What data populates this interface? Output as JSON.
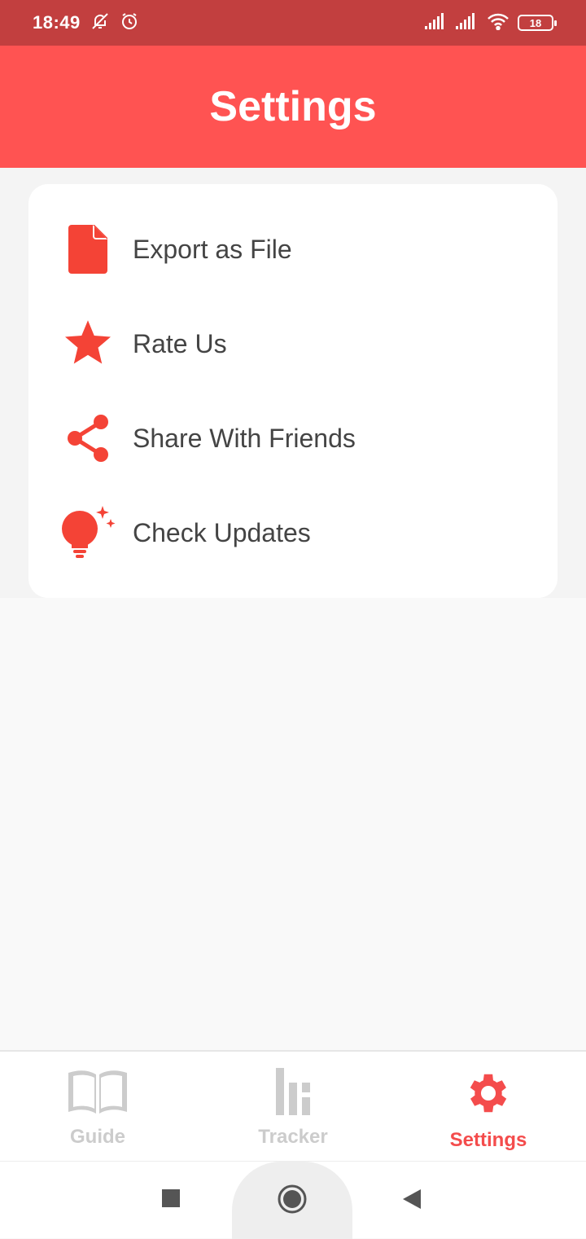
{
  "status_bar": {
    "time": "18:49",
    "battery": "18",
    "icons": [
      "bell-off-icon",
      "alarm-icon",
      "signal-icon",
      "signal-icon",
      "wifi-icon",
      "battery-icon"
    ]
  },
  "header": {
    "title": "Settings"
  },
  "menu": {
    "items": [
      {
        "label": "Export as File",
        "icon": "file-icon"
      },
      {
        "label": "Rate Us",
        "icon": "star-icon"
      },
      {
        "label": "Share With Friends",
        "icon": "share-icon"
      },
      {
        "label": "Check Updates",
        "icon": "lightbulb-icon"
      }
    ]
  },
  "bottom_nav": {
    "tabs": [
      {
        "label": "Guide",
        "icon": "book-icon",
        "active": false
      },
      {
        "label": "Tracker",
        "icon": "bar-chart-icon",
        "active": false
      },
      {
        "label": "Settings",
        "icon": "gear-icon",
        "active": true
      }
    ]
  },
  "colors": {
    "status_bar": "#c23f3f",
    "header": "#ff5352",
    "accent": "#f44c4c",
    "inactive": "#cccccc"
  }
}
